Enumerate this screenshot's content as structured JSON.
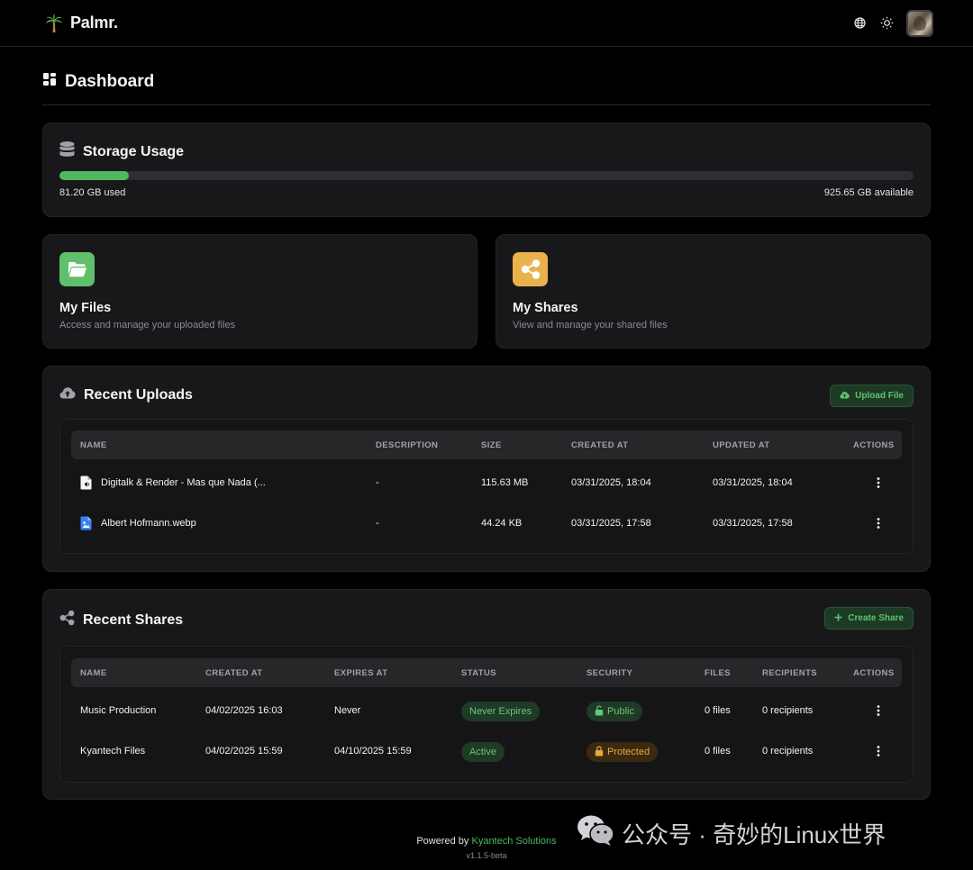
{
  "app": {
    "name": "Palmr."
  },
  "page": {
    "title": "Dashboard"
  },
  "storage": {
    "title": "Storage Usage",
    "used_label": "81.20 GB used",
    "available_label": "925.65 GB available",
    "used_fraction": 0.081,
    "accent": "#4fb95e"
  },
  "quick_cards": {
    "files": {
      "title": "My Files",
      "description": "Access and manage your uploaded files",
      "icon": "folder-open-icon",
      "color": "#5fbf6b"
    },
    "shares": {
      "title": "My Shares",
      "description": "View and manage your shared files",
      "icon": "share-icon",
      "color": "#e9b24c"
    }
  },
  "recent_uploads": {
    "title": "Recent Uploads",
    "upload_button": "Upload File",
    "columns": [
      "NAME",
      "DESCRIPTION",
      "SIZE",
      "CREATED AT",
      "UPDATED AT",
      "ACTIONS"
    ],
    "rows": [
      {
        "name": "Digitalk & Render - Mas que Nada (...",
        "description": "-",
        "size": "115.63 MB",
        "created": "03/31/2025, 18:04",
        "updated": "03/31/2025, 18:04",
        "icon": "audio-file-icon"
      },
      {
        "name": "Albert Hofmann.webp",
        "description": "-",
        "size": "44.24 KB",
        "created": "03/31/2025, 17:58",
        "updated": "03/31/2025, 17:58",
        "icon": "image-file-icon"
      }
    ]
  },
  "recent_shares": {
    "title": "Recent Shares",
    "create_button": "Create Share",
    "columns": [
      "NAME",
      "CREATED AT",
      "EXPIRES AT",
      "STATUS",
      "SECURITY",
      "FILES",
      "RECIPIENTS",
      "ACTIONS"
    ],
    "rows": [
      {
        "name": "Music Production",
        "created": "04/02/2025 16:03",
        "expires": "Never",
        "status": "Never Expires",
        "security": "Public",
        "files": "0 files",
        "recipients": "0 recipients"
      },
      {
        "name": "Kyantech Files",
        "created": "04/02/2025 15:59",
        "expires": "04/10/2025 15:59",
        "status": "Active",
        "security": "Protected",
        "files": "0 files",
        "recipients": "0 recipients"
      }
    ]
  },
  "footer": {
    "powered_prefix": "Powered by",
    "company": "Kyantech Solutions",
    "version": "v1.1.5-beta"
  },
  "watermark": {
    "text": "公众号 · 奇妙的Linux世界"
  }
}
